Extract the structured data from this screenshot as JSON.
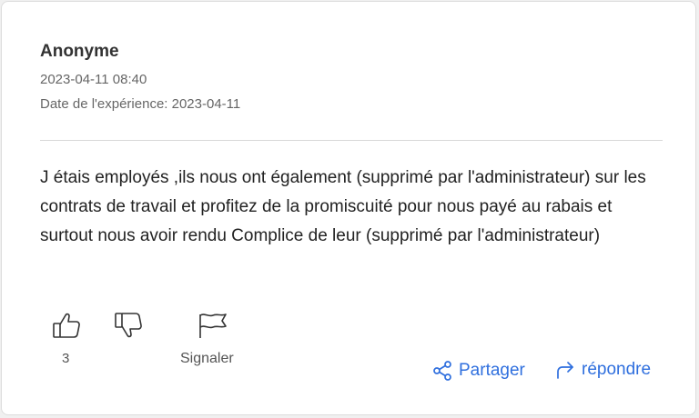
{
  "review": {
    "author": "Anonyme",
    "datetime": "2023-04-11 08:40",
    "experience_date": "Date de l'expérience: 2023-04-11",
    "text": "J étais employés ,ils nous ont également (supprimé par l'administrateur) sur les contrats de travail et profitez de la promiscuité pour nous payé au rabais et surtout nous avoir rendu Complice de leur (supprimé par l'administrateur)"
  },
  "actions": {
    "like_icon": "thumbs-up-icon",
    "dislike_icon": "thumbs-down-icon",
    "flag_icon": "flag-icon",
    "like_count": "3",
    "report_label": "Signaler",
    "share_label": "Partager",
    "reply_label": "répondre"
  },
  "colors": {
    "link": "#2f6fde",
    "text": "#222222",
    "muted": "#666666"
  }
}
